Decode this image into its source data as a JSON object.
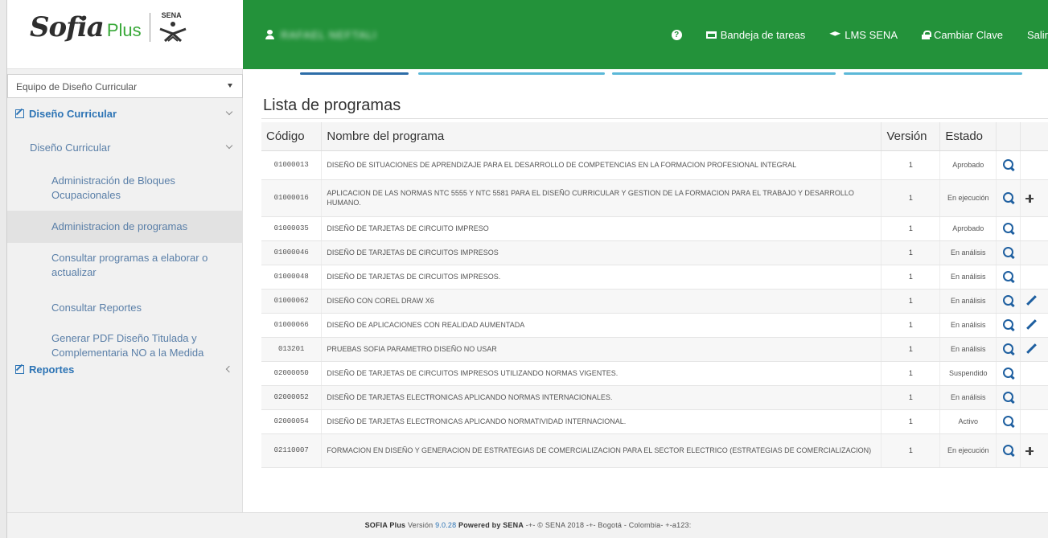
{
  "brand": {
    "name": "Sofia",
    "suffix": "Plus",
    "partner": "SENA"
  },
  "header": {
    "user_name": "RAFAEL NEFTALI",
    "help_glyph": "?",
    "nav": [
      {
        "label": "Bandeja de tareas",
        "icon": "inbox-icon"
      },
      {
        "label": "LMS SENA",
        "icon": "graduation-cap-icon"
      },
      {
        "label": "Cambiar Clave",
        "icon": "lock-icon"
      },
      {
        "label": "Salir",
        "icon": ""
      }
    ]
  },
  "sidebar": {
    "role_select": "Equipo de Diseño Curricular",
    "sections": [
      {
        "label": "Diseño Curricular"
      },
      {
        "label": "Reportes"
      }
    ],
    "submenu": "Diseño Curricular",
    "items": [
      "Administración de Bloques Ocupacionales",
      "Administracion de programas",
      "Consultar programas a elaborar o actualizar",
      "Consultar Reportes",
      "Generar PDF Diseño Titulada y Complementaria NO a la Medida"
    ],
    "active_index": 1
  },
  "main": {
    "title": "Lista de programas",
    "tab_colors": [
      "#2d6da8",
      "#5bb8d8",
      "#5bb8d8",
      "#5bb8d8"
    ],
    "columns": [
      "Código",
      "Nombre del programa",
      "Versión",
      "Estado",
      "",
      ""
    ],
    "rows": [
      {
        "code": "01000013",
        "name": "DISEÑO DE SITUACIONES DE APRENDIZAJE PARA EL DESARROLLO DE COMPETENCIAS EN LA FORMACION PROFESIONAL INTEGRAL",
        "version": "1",
        "state": "Aprobado",
        "extra": ""
      },
      {
        "code": "01000016",
        "name": "APLICACION DE LAS NORMAS NTC 5555 Y NTC 5581 PARA EL DISEÑO CURRICULAR Y GESTION DE LA FORMACION PARA EL TRABAJO Y DESARROLLO HUMANO.",
        "version": "1",
        "state": "En ejecución",
        "extra": "plus"
      },
      {
        "code": "01000035",
        "name": "DISEÑO DE TARJETAS DE CIRCUITO IMPRESO",
        "version": "1",
        "state": "Aprobado",
        "extra": ""
      },
      {
        "code": "01000046",
        "name": "DISEÑO DE TARJETAS DE CIRCUITOS IMPRESOS",
        "version": "1",
        "state": "En análisis",
        "extra": ""
      },
      {
        "code": "01000048",
        "name": "DISEÑO DE TARJETAS DE CIRCUITOS IMPRESOS.",
        "version": "1",
        "state": "En análisis",
        "extra": ""
      },
      {
        "code": "01000062",
        "name": "DISEÑO CON COREL DRAW X6",
        "version": "1",
        "state": "En análisis",
        "extra": "pencil"
      },
      {
        "code": "01000066",
        "name": "DISEÑO DE APLICACIONES CON REALIDAD AUMENTADA",
        "version": "1",
        "state": "En análisis",
        "extra": "pencil"
      },
      {
        "code": "013201",
        "name": "PRUEBAS SOFIA PARAMETRO DISEÑO NO USAR",
        "version": "1",
        "state": "En análisis",
        "extra": "pencil"
      },
      {
        "code": "02000050",
        "name": "DISEÑO DE TARJETAS DE CIRCUITOS IMPRESOS UTILIZANDO NORMAS VIGENTES.",
        "version": "1",
        "state": "Suspendido",
        "extra": ""
      },
      {
        "code": "02000052",
        "name": "DISEÑO DE TARJETAS ELECTRONICAS APLICANDO NORMAS INTERNACIONALES.",
        "version": "1",
        "state": "En análisis",
        "extra": ""
      },
      {
        "code": "02000054",
        "name": "DISEÑO DE TARJETAS ELECTRONICAS APLICANDO NORMATIVIDAD INTERNACIONAL.",
        "version": "1",
        "state": "Activo",
        "extra": ""
      },
      {
        "code": "02110007",
        "name": "FORMACION EN DISEÑO Y GENERACION DE ESTRATEGIAS DE COMERCIALIZACION PARA EL SECTOR ELECTRICO (ESTRATEGIAS DE COMERCIALIZACION)",
        "version": "1",
        "state": "En ejecución",
        "extra": "plus"
      }
    ]
  },
  "footer": {
    "product": "SOFIA Plus",
    "version_label": "Versión",
    "version": "9.0.28",
    "powered": "Powered by",
    "org": "SENA",
    "rest": "-+- © SENA 2018 -+- Bogotá - Colombia- +-a123:"
  },
  "colors": {
    "topbar": "#23923a",
    "link": "#2d74b5",
    "action_icon": "#1e5fa0"
  }
}
